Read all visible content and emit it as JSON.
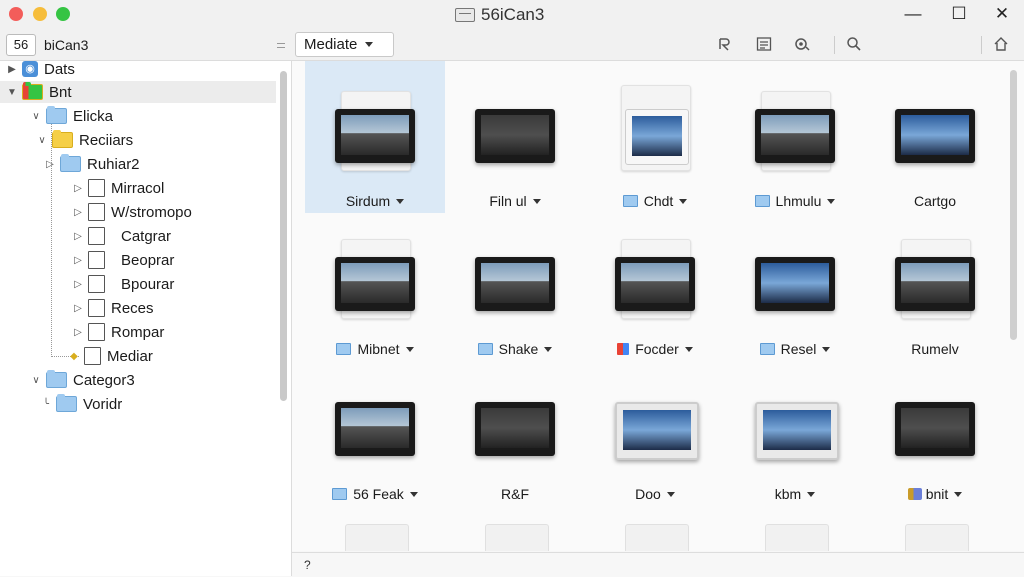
{
  "window": {
    "title": "56iCan3",
    "minimize_glyph": "—",
    "maximize_glyph": "☐",
    "close_glyph": "✕"
  },
  "toolbar": {
    "app_badge": "56",
    "app_name": "biCan3",
    "path": "Mediate ",
    "icons": [
      "refresh-icon",
      "list-icon",
      "settings-icon",
      "search-icon",
      "home-icon"
    ]
  },
  "sidebar": {
    "items": [
      {
        "label": "Dats"
      },
      {
        "label": "Bnt"
      },
      {
        "label": "Elicka"
      },
      {
        "label": "Reciiars"
      },
      {
        "label": "Ruhiar2"
      },
      {
        "label": "Mirracol"
      },
      {
        "label": "W/stromopo"
      },
      {
        "label": "Catgrar"
      },
      {
        "label": "Beoprar"
      },
      {
        "label": "Bpourar"
      },
      {
        "label": "Reces"
      },
      {
        "label": "Rompar"
      },
      {
        "label": "Mediar"
      },
      {
        "label": "Categor3"
      },
      {
        "label": "Voridr"
      }
    ]
  },
  "grid": {
    "tiles": [
      {
        "label": "Sirdum"
      },
      {
        "label": "Filn ul"
      },
      {
        "label": "Chdt"
      },
      {
        "label": "Lhmulu"
      },
      {
        "label": "Cartgo"
      },
      {
        "label": "Mibnet"
      },
      {
        "label": "Shake"
      },
      {
        "label": "Focder"
      },
      {
        "label": "Resel"
      },
      {
        "label": "Rumelv"
      },
      {
        "label": "56 Feak"
      },
      {
        "label": "R&F"
      },
      {
        "label": "Doo"
      },
      {
        "label": "kbm"
      },
      {
        "label": "bnit"
      }
    ]
  },
  "status": {
    "text": "?"
  },
  "colors": {
    "selection": "#dbe9f6",
    "folder_blue": "#9fcaf0",
    "folder_yellow": "#f5cf47"
  }
}
